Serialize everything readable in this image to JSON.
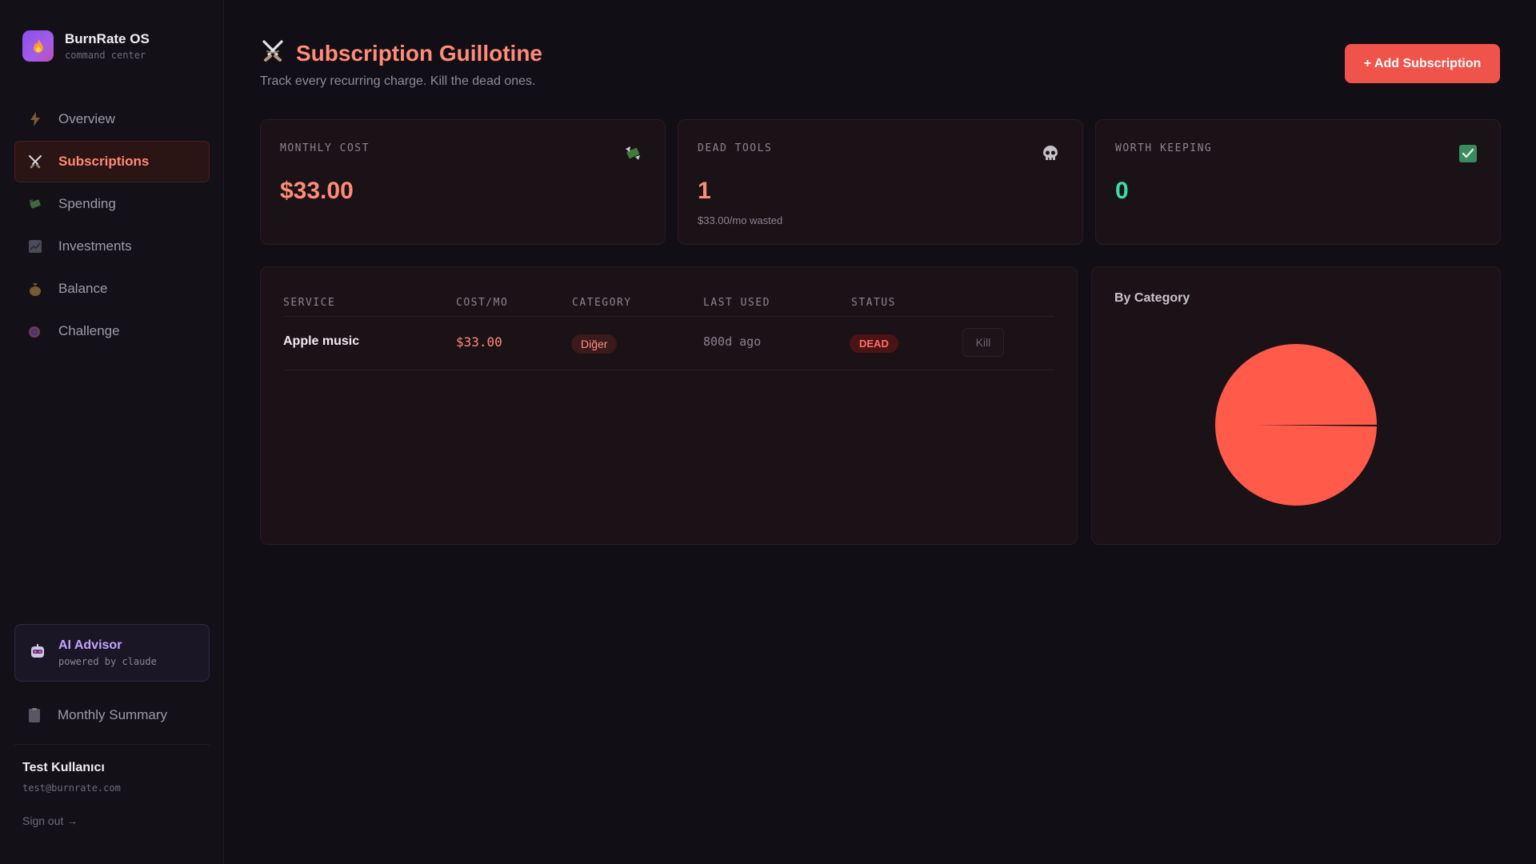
{
  "app": {
    "name": "BurnRate OS",
    "subtitle": "command center"
  },
  "sidebar": {
    "items": [
      {
        "label": "Overview",
        "icon": "lightning-icon"
      },
      {
        "label": "Subscriptions",
        "icon": "crossed-swords-icon",
        "active": true
      },
      {
        "label": "Spending",
        "icon": "money-wings-icon"
      },
      {
        "label": "Investments",
        "icon": "chart-icon"
      },
      {
        "label": "Balance",
        "icon": "money-bag-icon"
      },
      {
        "label": "Challenge",
        "icon": "target-icon"
      }
    ],
    "advisor": {
      "title": "AI Advisor",
      "subtitle": "powered by claude"
    },
    "summary_label": "Monthly Summary",
    "user": {
      "name": "Test Kullanıcı",
      "email": "test@burnrate.com"
    },
    "signout": "Sign out →"
  },
  "header": {
    "title": "Subscription Guillotine",
    "subtitle": "Track every recurring charge. Kill the dead ones.",
    "add_button": "+ Add Subscription"
  },
  "stats": {
    "monthly_cost": {
      "label": "MONTHLY COST",
      "value": "$33.00"
    },
    "dead_tools": {
      "label": "DEAD TOOLS",
      "value": "1",
      "sub": "$33.00/mo wasted"
    },
    "worth_keeping": {
      "label": "WORTH KEEPING",
      "value": "0"
    }
  },
  "table": {
    "headers": {
      "service": "SERVICE",
      "cost": "COST/MO",
      "category": "CATEGORY",
      "last_used": "LAST USED",
      "status": "STATUS"
    },
    "rows": [
      {
        "service": "Apple music",
        "cost": "$33.00",
        "category": "Diğer",
        "last_used": "800d ago",
        "status": "DEAD",
        "action": "Kill"
      }
    ]
  },
  "category_chart": {
    "title": "By Category"
  },
  "chart_data": {
    "type": "pie",
    "title": "By Category",
    "slices": [
      {
        "label": "Diğer",
        "value": 33.0,
        "color": "#ff5a4a"
      }
    ]
  },
  "colors": {
    "accent": "#f0534a",
    "accent_text": "#ff8b7a",
    "positive": "#3ddba8",
    "background": "#110f15"
  }
}
